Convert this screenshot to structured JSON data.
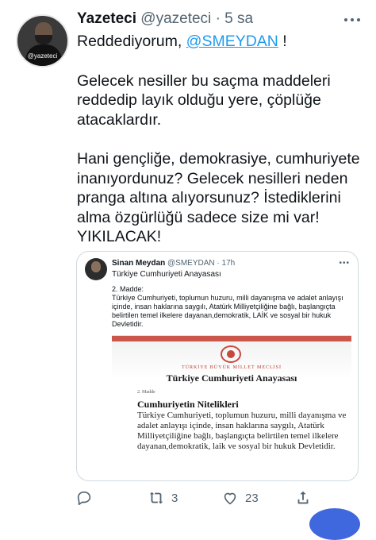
{
  "tweet": {
    "author_name": "Yazeteci",
    "author_handle": "@yazeteci",
    "separator": "·",
    "time": "5 sa",
    "avatar_tag": "@yazeteci",
    "line1_prefix": "Reddediyorum, ",
    "mention": "@SMEYDAN",
    "line1_suffix": " !",
    "paragraph2": "Gelecek nesiller bu saçma maddeleri reddedip layık olduğu yere, çöplüğe atacaklardır.",
    "paragraph3": "Hani gençliğe, demokrasiye, cumhuriyete inanıyordunuz? Gelecek nesilleri neden pranga altına alıyorsunuz? İstediklerini alma özgürlüğü sadece size mi var! YIKILACAK!"
  },
  "quoted": {
    "name": "Sinan Meydan",
    "handle": "@SMEYDAN",
    "time": "· 17h",
    "subtitle": "Türkiye Cumhuriyeti Anayasası",
    "body_line1": "2. Madde:",
    "body_line2": "Türkiye Cumhuriyeti, toplumun huzuru, milli dayanışma ve adalet anlayışı içinde, insan haklarına saygılı, Atatürk Milliyetçiliğine bağlı, başlangıçta belirtilen temel ilkelere dayanan,demokratik, LAİK ve sosyal bir hukuk Devletidir.",
    "doc_mini": "TÜRKİYE BÜYÜK MİLLET MECLİSİ",
    "doc_title": "Türkiye Cumhuriyeti Anayasası",
    "doc_madde": "2. Madde",
    "doc_heading": "Cumhuriyetin Nitelikleri",
    "doc_text": "Türkiye Cumhuriyeti, toplumun huzuru, milli dayanışma ve adalet anlayışı içinde, insan haklarına saygılı, Atatürk Milliyetçiliğine bağlı, başlangıçta belirtilen temel ilkelere dayanan,demokratik, laik ve sosyal bir hukuk Devletidir."
  },
  "actions": {
    "reply_icon": "reply-icon",
    "retweet_icon": "retweet-icon",
    "retweet_count": "3",
    "like_icon": "heart-icon",
    "like_count": "23",
    "share_icon": "share-icon"
  },
  "colors": {
    "link": "#1d9bf0",
    "muted": "#536471",
    "text": "#0f1419"
  }
}
